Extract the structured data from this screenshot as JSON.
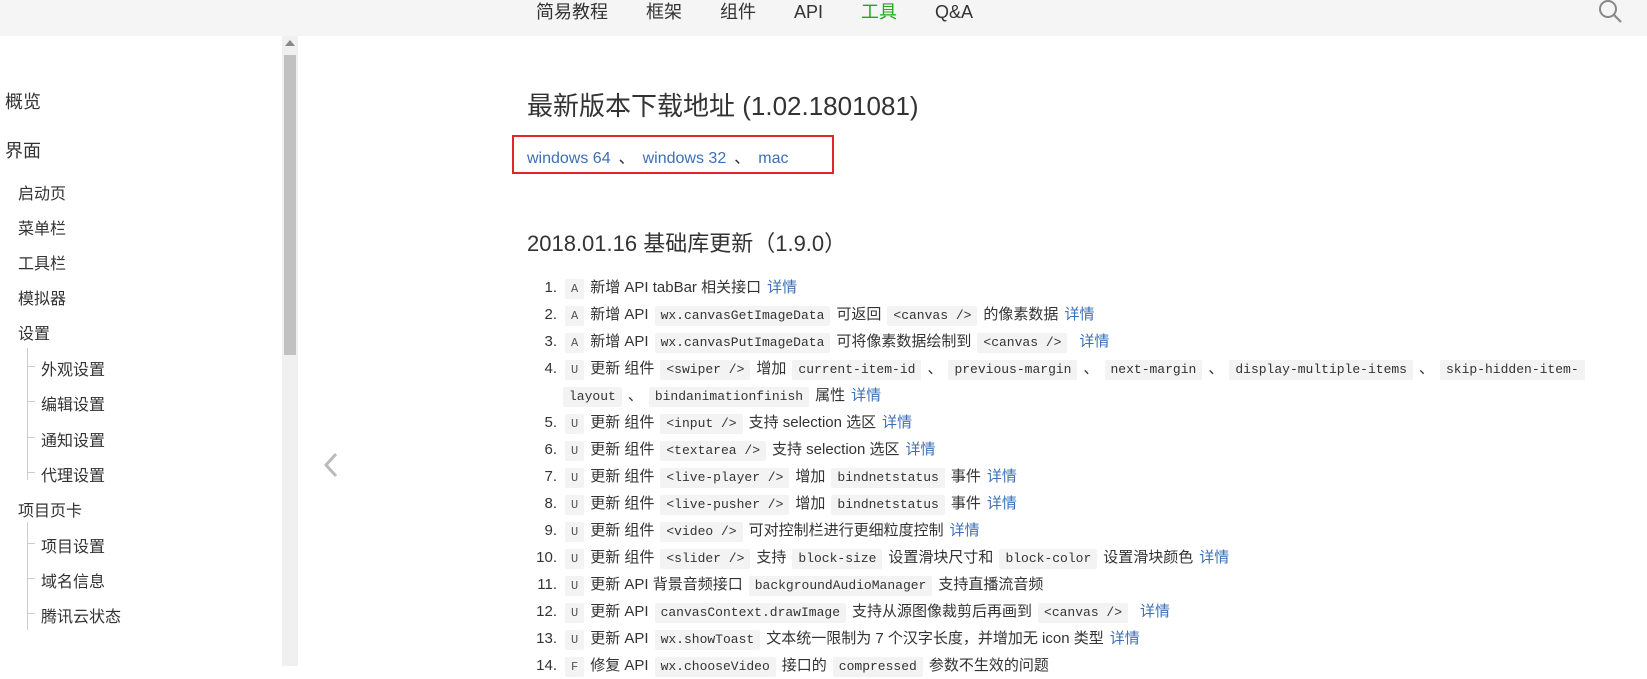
{
  "top_nav": {
    "items": [
      {
        "label": "简易教程",
        "active": false
      },
      {
        "label": "框架",
        "active": false
      },
      {
        "label": "组件",
        "active": false
      },
      {
        "label": "API",
        "active": false
      },
      {
        "label": "工具",
        "active": true
      },
      {
        "label": "Q&A",
        "active": false
      }
    ],
    "search_icon": "search-icon",
    "active_color": "#1aad19"
  },
  "sidebar": {
    "items": [
      {
        "label": "概览",
        "level": 1
      },
      {
        "label": "界面",
        "level": 1
      },
      {
        "label": "启动页",
        "level": 2
      },
      {
        "label": "菜单栏",
        "level": 2
      },
      {
        "label": "工具栏",
        "level": 2
      },
      {
        "label": "模拟器",
        "level": 2
      },
      {
        "label": "设置",
        "level": 2
      },
      {
        "label": "外观设置",
        "level": 3
      },
      {
        "label": "编辑设置",
        "level": 3
      },
      {
        "label": "通知设置",
        "level": 3
      },
      {
        "label": "代理设置",
        "level": 3
      },
      {
        "label": "项目页卡",
        "level": 2
      },
      {
        "label": "项目设置",
        "level": 3
      },
      {
        "label": "域名信息",
        "level": 3
      },
      {
        "label": "腾讯云状态",
        "level": 3
      }
    ]
  },
  "main": {
    "title": "最新版本下载地址 (1.02.1801081)",
    "downloads": {
      "links": [
        "windows 64",
        "windows 32",
        "mac"
      ],
      "separator": "、",
      "highlight_color": "#e0262a"
    },
    "update_heading": "2018.01.16 基础库更新（1.9.0）",
    "detail_label": "详情",
    "link_color": "#3c6fb8",
    "items": [
      {
        "num": "1.",
        "badge": "A",
        "parts": [
          {
            "t": "新增 API tabBar 相关接口"
          }
        ]
      },
      {
        "num": "2.",
        "badge": "A",
        "parts": [
          {
            "t": "新增 API"
          },
          {
            "c": "wx.canvasGetImageData"
          },
          {
            "t": "可返回"
          },
          {
            "c": "<canvas />"
          },
          {
            "t": "的像素数据"
          }
        ]
      },
      {
        "num": "3.",
        "badge": "A",
        "parts": [
          {
            "t": "新增 API"
          },
          {
            "c": "wx.canvasPutImageData"
          },
          {
            "t": "可将像素数据绘制到"
          },
          {
            "c": "<canvas />"
          }
        ]
      },
      {
        "num": "4.",
        "badge": "U",
        "parts": [
          {
            "t": "更新 组件"
          },
          {
            "c": "<swiper />"
          },
          {
            "t": "增加"
          },
          {
            "c": "current-item-id"
          },
          {
            "t": "、"
          },
          {
            "c": "previous-margin"
          },
          {
            "t": "、"
          },
          {
            "c": "next-margin"
          },
          {
            "t": "、"
          },
          {
            "c": "display-multiple-items"
          },
          {
            "t": "、"
          },
          {
            "c": "skip-hidden-item-"
          }
        ],
        "wrap": [
          {
            "c": "layout"
          },
          {
            "t": "、"
          },
          {
            "c": "bindanimationfinish"
          },
          {
            "t": "属性"
          }
        ]
      },
      {
        "num": "5.",
        "badge": "U",
        "parts": [
          {
            "t": "更新 组件"
          },
          {
            "c": "<input />"
          },
          {
            "t": "支持 selection 选区"
          }
        ]
      },
      {
        "num": "6.",
        "badge": "U",
        "parts": [
          {
            "t": "更新 组件"
          },
          {
            "c": "<textarea />"
          },
          {
            "t": "支持 selection 选区"
          }
        ]
      },
      {
        "num": "7.",
        "badge": "U",
        "parts": [
          {
            "t": "更新 组件"
          },
          {
            "c": "<live-player />"
          },
          {
            "t": "增加"
          },
          {
            "c": "bindnetstatus"
          },
          {
            "t": "事件"
          }
        ]
      },
      {
        "num": "8.",
        "badge": "U",
        "parts": [
          {
            "t": "更新 组件"
          },
          {
            "c": "<live-pusher />"
          },
          {
            "t": "增加"
          },
          {
            "c": "bindnetstatus"
          },
          {
            "t": "事件"
          }
        ]
      },
      {
        "num": "9.",
        "badge": "U",
        "parts": [
          {
            "t": "更新 组件"
          },
          {
            "c": "<video />"
          },
          {
            "t": "可对控制栏进行更细粒度控制"
          }
        ]
      },
      {
        "num": "10.",
        "badge": "U",
        "parts": [
          {
            "t": "更新 组件"
          },
          {
            "c": "<slider />"
          },
          {
            "t": "支持"
          },
          {
            "c": "block-size"
          },
          {
            "t": "设置滑块尺寸和"
          },
          {
            "c": "block-color"
          },
          {
            "t": "设置滑块颜色"
          }
        ]
      },
      {
        "num": "11.",
        "badge": "U",
        "parts": [
          {
            "t": "更新 API 背景音频接口"
          },
          {
            "c": "backgroundAudioManager"
          },
          {
            "t": "支持直播流音频"
          }
        ],
        "no_detail": true
      },
      {
        "num": "12.",
        "badge": "U",
        "parts": [
          {
            "t": "更新 API"
          },
          {
            "c": "canvasContext.drawImage"
          },
          {
            "t": "支持从源图像裁剪后再画到"
          },
          {
            "c": "<canvas />"
          }
        ]
      },
      {
        "num": "13.",
        "badge": "U",
        "parts": [
          {
            "t": "更新 API"
          },
          {
            "c": "wx.showToast"
          },
          {
            "t": "文本统一限制为 7 个汉字长度，并增加无 icon 类型"
          }
        ]
      },
      {
        "num": "14.",
        "badge": "F",
        "parts": [
          {
            "t": "修复 API"
          },
          {
            "c": "wx.chooseVideo"
          },
          {
            "t": "接口的"
          },
          {
            "c": "compressed"
          },
          {
            "t": "参数不生效的问题"
          }
        ],
        "no_detail": true
      }
    ]
  }
}
